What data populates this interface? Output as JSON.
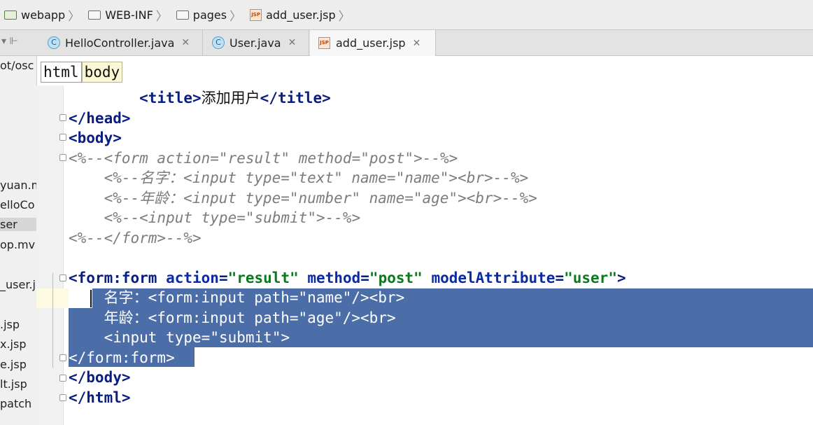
{
  "breadcrumbs": [
    {
      "label": "webapp",
      "icon": "web-folder-icon"
    },
    {
      "label": "WEB-INF",
      "icon": "folder-icon"
    },
    {
      "label": "pages",
      "icon": "folder-icon"
    },
    {
      "label": "add_user.jsp",
      "icon": "jsp-file-icon"
    }
  ],
  "tabs": [
    {
      "label": "HelloController.java",
      "icon": "java-class-icon"
    },
    {
      "label": "User.java",
      "icon": "java-class-icon"
    },
    {
      "label": "add_user.jsp",
      "icon": "jsp-file-icon",
      "active": true
    }
  ],
  "project_tree": {
    "items": [
      "ot/osc",
      "yuan.m",
      "elloCo",
      "ser",
      "op.mv",
      "_user.j",
      ".jsp",
      "x.jsp",
      "e.jsp",
      "lt.jsp",
      "patch"
    ],
    "selected": "ser"
  },
  "tag_path": [
    "html",
    "body"
  ],
  "code_lines": [
    [
      [
        "",
        "        "
      ],
      [
        "t",
        "<title>"
      ],
      [
        "tx",
        "添加用户"
      ],
      [
        "t",
        "</title>"
      ]
    ],
    [
      [
        "t",
        "</head>"
      ]
    ],
    [
      [
        "t",
        "<body>"
      ]
    ],
    [
      [
        "cm",
        "<%--<form action=\"result\" method=\"post\">--%>"
      ]
    ],
    [
      [
        "cm",
        "    <%--名字：<input type=\"text\" name=\"name\"><br>--%>"
      ]
    ],
    [
      [
        "cm",
        "    <%--年龄：<input type=\"number\" name=\"age\"><br>--%>"
      ]
    ],
    [
      [
        "cm",
        "    <%--<input type=\"submit\">--%>"
      ]
    ],
    [
      [
        "cm",
        "<%--</form>--%>"
      ]
    ],
    [],
    [
      [
        "t",
        "<form:form "
      ],
      [
        "a",
        "action"
      ],
      [
        "t",
        "="
      ],
      [
        "v",
        "\"result\""
      ],
      [
        "t",
        " "
      ],
      [
        "a",
        "method"
      ],
      [
        "t",
        "="
      ],
      [
        "v",
        "\"post\""
      ],
      [
        "t",
        " "
      ],
      [
        "a",
        "modelAttribute"
      ],
      [
        "t",
        "="
      ],
      [
        "v",
        "\"user\""
      ],
      [
        "t",
        ">"
      ]
    ],
    [
      [
        "",
        "    "
      ],
      [
        "tx",
        "名字："
      ],
      [
        "t",
        "<form:input "
      ],
      [
        "a",
        "path"
      ],
      [
        "t",
        "="
      ],
      [
        "v",
        "\"name\""
      ],
      [
        "t",
        "/><br>"
      ]
    ],
    [
      [
        "",
        "    "
      ],
      [
        "tx",
        "年龄："
      ],
      [
        "t",
        "<form:input "
      ],
      [
        "a",
        "path"
      ],
      [
        "t",
        "="
      ],
      [
        "v",
        "\"age\""
      ],
      [
        "t",
        "/><br>"
      ]
    ],
    [
      [
        "",
        "    "
      ],
      [
        "t",
        "<input "
      ],
      [
        "a",
        "type"
      ],
      [
        "t",
        "="
      ],
      [
        "v",
        "\"submit\""
      ],
      [
        "t",
        ">"
      ]
    ],
    [
      [
        "t",
        "</form:form>"
      ]
    ],
    [
      [
        "t",
        "</body>"
      ]
    ],
    [
      [
        "t",
        "</html>"
      ]
    ]
  ],
  "selected_lines": [
    10,
    11,
    12,
    13
  ],
  "colors": {
    "selection": "#4c6ea8",
    "tag": "#0a1d80",
    "attribute": "#0b2aa8",
    "value": "#0a7a1e",
    "comment": "#7c7c7c"
  }
}
